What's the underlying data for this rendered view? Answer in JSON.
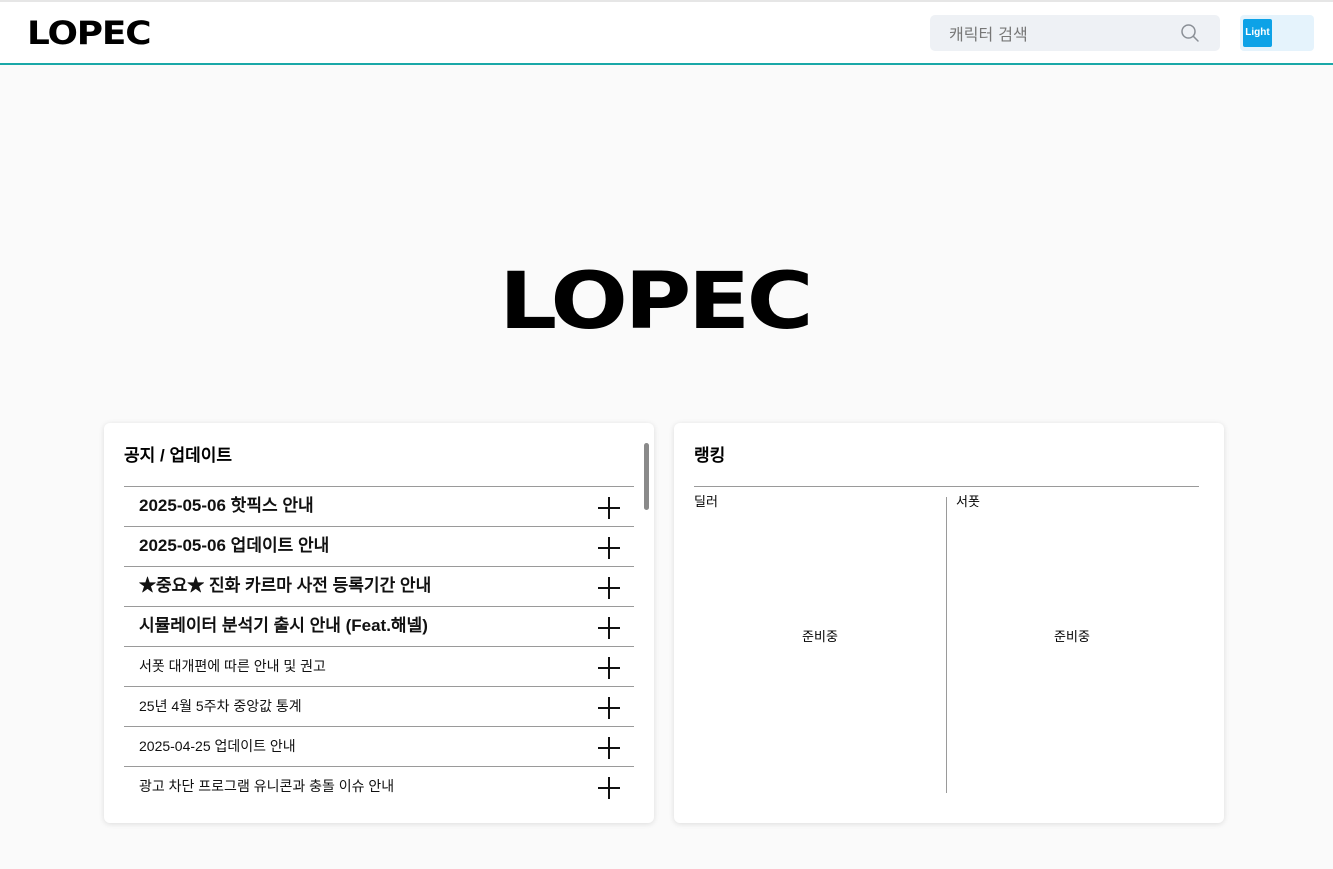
{
  "header": {
    "logo": "LOPEC",
    "search_placeholder": "캐릭터 검색",
    "theme_label": "Light"
  },
  "hero": {
    "logo": "LOPEC"
  },
  "notice": {
    "title": "공지 / 업데이트",
    "items": [
      {
        "label": "2025-05-06 핫픽스 안내"
      },
      {
        "label": "2025-05-06 업데이트 안내"
      },
      {
        "label": "★중요★ 진화 카르마 사전 등록기간 안내"
      },
      {
        "label": "시뮬레이터 분석기 출시 안내 (Feat.해넬)"
      },
      {
        "label": "서폿 대개편에 따른 안내 및 권고"
      },
      {
        "label": "25년 4월 5주차 중앙값 통계"
      },
      {
        "label": "2025-04-25 업데이트 안내"
      },
      {
        "label": "광고 차단 프로그램 유니콘과 충돌 이슈 안내"
      }
    ]
  },
  "ranking": {
    "title": "랭킹",
    "dealer_label": "딜러",
    "support_label": "서폿",
    "dealer_status": "준비중",
    "support_status": "준비중"
  },
  "colors": {
    "accent": "#1aa8a8",
    "theme_button": "#0da2e7"
  }
}
